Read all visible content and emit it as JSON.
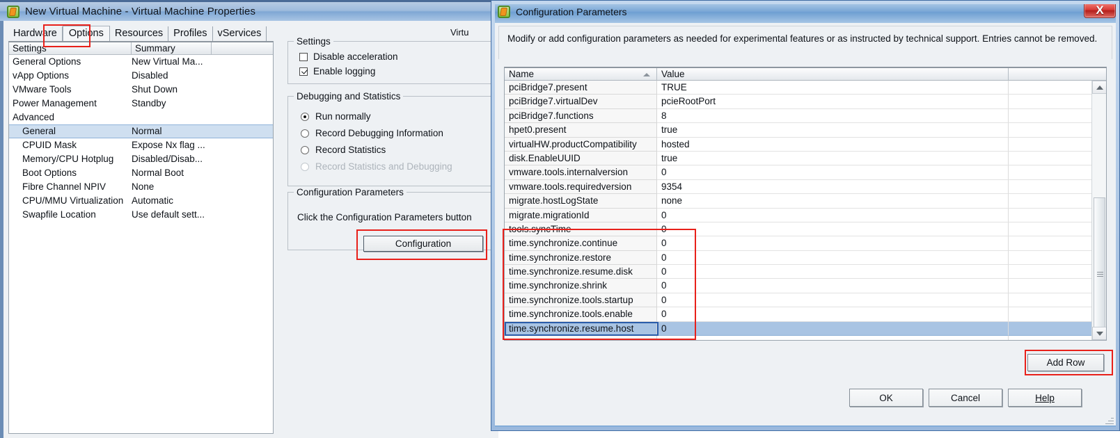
{
  "vm_window": {
    "title": "New Virtual Machine - Virtual Machine Properties",
    "icon": "vmware-vm-icon",
    "version_label": "Virtu",
    "tabs": [
      {
        "label": "Hardware",
        "active": false
      },
      {
        "label": "Options",
        "active": true
      },
      {
        "label": "Resources",
        "active": false
      },
      {
        "label": "Profiles",
        "active": false
      },
      {
        "label": "vServices",
        "active": false
      }
    ],
    "settings_grid": {
      "columns": [
        "Settings",
        "Summary",
        ""
      ],
      "rows": [
        {
          "name": "General Options",
          "summary": "New Virtual Ma...",
          "indent": false,
          "selected": false
        },
        {
          "name": "vApp Options",
          "summary": "Disabled",
          "indent": false,
          "selected": false
        },
        {
          "name": "VMware Tools",
          "summary": "Shut Down",
          "indent": false,
          "selected": false
        },
        {
          "name": "Power Management",
          "summary": "Standby",
          "indent": false,
          "selected": false
        },
        {
          "name": "Advanced",
          "summary": "",
          "indent": false,
          "selected": false
        },
        {
          "name": "General",
          "summary": "Normal",
          "indent": true,
          "selected": true
        },
        {
          "name": "CPUID Mask",
          "summary": "Expose Nx flag ...",
          "indent": true,
          "selected": false
        },
        {
          "name": "Memory/CPU Hotplug",
          "summary": "Disabled/Disab...",
          "indent": true,
          "selected": false
        },
        {
          "name": "Boot Options",
          "summary": "Normal Boot",
          "indent": true,
          "selected": false
        },
        {
          "name": "Fibre Channel NPIV",
          "summary": "None",
          "indent": true,
          "selected": false
        },
        {
          "name": "CPU/MMU Virtualization",
          "summary": "Automatic",
          "indent": true,
          "selected": false
        },
        {
          "name": "Swapfile Location",
          "summary": "Use default sett...",
          "indent": true,
          "selected": false
        }
      ]
    },
    "settings_group": {
      "title": "Settings",
      "checkboxes": [
        {
          "label": "Disable acceleration",
          "checked": false
        },
        {
          "label": "Enable logging",
          "checked": true
        }
      ]
    },
    "debug_group": {
      "title": "Debugging and Statistics",
      "radios": [
        {
          "label": "Run normally",
          "selected": true,
          "disabled": false
        },
        {
          "label": "Record Debugging Information",
          "selected": false,
          "disabled": false
        },
        {
          "label": "Record Statistics",
          "selected": false,
          "disabled": false
        },
        {
          "label": "Record Statistics and Debugging",
          "selected": false,
          "disabled": true
        }
      ]
    },
    "config_group": {
      "title": "Configuration Parameters",
      "hint": "Click the Configuration Parameters button",
      "button_label": "Configuration"
    }
  },
  "cfg_dialog": {
    "title": "Configuration Parameters",
    "icon": "vmware-vm-icon",
    "close_label": "X",
    "description": "Modify or add configuration parameters as needed for experimental features or as instructed by technical support. Entries cannot be removed.",
    "table": {
      "columns": [
        "Name",
        "Value",
        ""
      ],
      "sort_column": "Name",
      "sort_direction": "ascending",
      "rows": [
        {
          "name": "pciBridge7.present",
          "value": "TRUE",
          "selected": false
        },
        {
          "name": "pciBridge7.virtualDev",
          "value": "pcieRootPort",
          "selected": false
        },
        {
          "name": "pciBridge7.functions",
          "value": "8",
          "selected": false
        },
        {
          "name": "hpet0.present",
          "value": "true",
          "selected": false
        },
        {
          "name": "virtualHW.productCompatibility",
          "value": "hosted",
          "selected": false
        },
        {
          "name": "disk.EnableUUID",
          "value": "true",
          "selected": false
        },
        {
          "name": "vmware.tools.internalversion",
          "value": "0",
          "selected": false
        },
        {
          "name": "vmware.tools.requiredversion",
          "value": "9354",
          "selected": false
        },
        {
          "name": "migrate.hostLogState",
          "value": "none",
          "selected": false
        },
        {
          "name": "migrate.migrationId",
          "value": "0",
          "selected": false
        },
        {
          "name": "tools.syncTime",
          "value": "0",
          "selected": false
        },
        {
          "name": "time.synchronize.continue",
          "value": "0",
          "selected": false
        },
        {
          "name": "time.synchronize.restore",
          "value": "0",
          "selected": false
        },
        {
          "name": "time.synchronize.resume.disk",
          "value": "0",
          "selected": false
        },
        {
          "name": "time.synchronize.shrink",
          "value": "0",
          "selected": false
        },
        {
          "name": "time.synchronize.tools.startup",
          "value": "0",
          "selected": false
        },
        {
          "name": "time.synchronize.tools.enable",
          "value": "0",
          "selected": false
        },
        {
          "name": "time.synchronize.resume.host",
          "value": "0",
          "selected": true
        }
      ]
    },
    "add_row_label": "Add Row",
    "buttons": {
      "ok": "OK",
      "cancel": "Cancel",
      "help": "Help"
    }
  },
  "annotations": {
    "accent_color": "#e8201a",
    "boxes": [
      {
        "name": "options-tab-highlight"
      },
      {
        "name": "configuration-button-highlight"
      },
      {
        "name": "time-sync-rows-highlight"
      },
      {
        "name": "add-row-button-highlight"
      }
    ]
  }
}
